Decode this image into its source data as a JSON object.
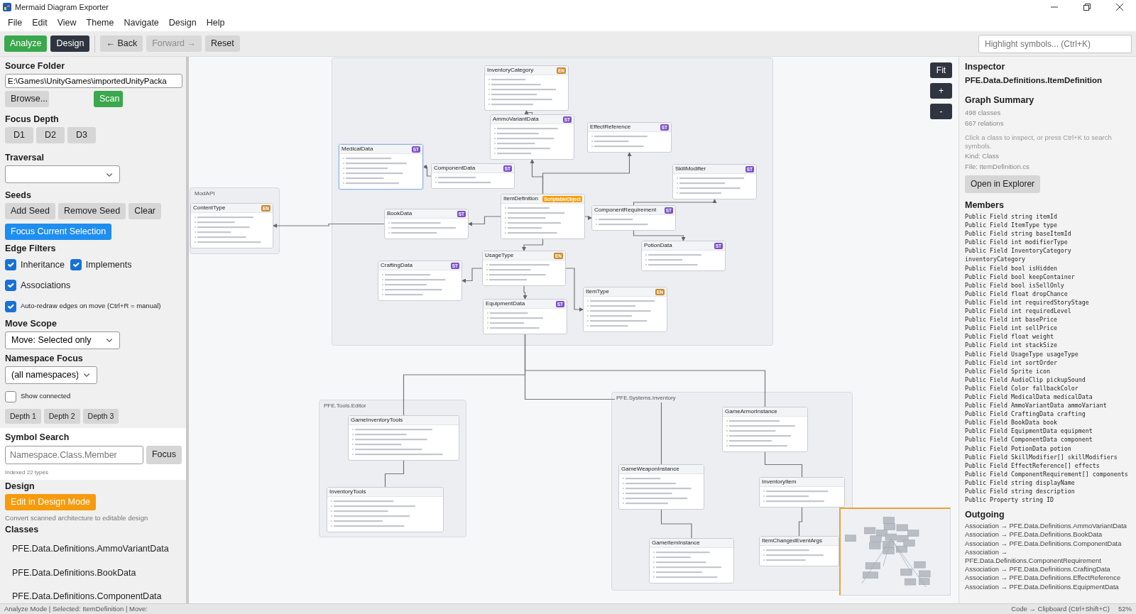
{
  "window": {
    "title": "Mermaid Diagram Exporter"
  },
  "menu": [
    "File",
    "Edit",
    "View",
    "Theme",
    "Navigate",
    "Design",
    "Help"
  ],
  "toolbar": {
    "modes": [
      {
        "label": "Analyze",
        "selected": true
      },
      {
        "label": "Design",
        "selected": false
      }
    ],
    "nav": [
      {
        "label": "← Back",
        "disabled": false
      },
      {
        "label": "Forward →",
        "disabled": true
      },
      {
        "label": "Reset",
        "disabled": false
      }
    ],
    "search": {
      "placeholder": "Highlight symbols... (Ctrl+K)"
    }
  },
  "left_panel": {
    "source_folder": {
      "label": "Source Folder",
      "value": "E:\\Games\\UnityGames\\importedUnityPacka",
      "browse": "Browse...",
      "scan": "Scan"
    },
    "focus_depth": {
      "label": "Focus Depth",
      "buttons": [
        "D1",
        "D2",
        "D3"
      ]
    },
    "traversal": {
      "label": "Traversal"
    },
    "seeds": {
      "label": "Seeds",
      "buttons": [
        "Add Seed",
        "Remove Seed",
        "Clear"
      ],
      "focus": "Focus Current Selection"
    },
    "edge_filters": {
      "label": "Edge Filters",
      "items": [
        {
          "label": "Inheritance",
          "checked": true
        },
        {
          "label": "Implements",
          "checked": true
        },
        {
          "label": "Associations",
          "checked": true
        },
        {
          "label": "Auto-redraw edges on move (Ctrl+R = manual)",
          "checked": true
        }
      ]
    },
    "move_scope": {
      "label": "Move Scope",
      "value": "Move: Selected only"
    },
    "namespace_focus": {
      "label": "Namespace Focus",
      "value": "(all namespaces)",
      "show_connected": {
        "label": "Show connected",
        "checked": false
      },
      "depth_buttons": [
        "Depth 1",
        "Depth 2",
        "Depth 3"
      ]
    },
    "symbol_search": {
      "label": "Symbol Search",
      "placeholder": "Namespace.Class.Member",
      "button": "Focus",
      "note": "Indexed 22 types"
    },
    "design": {
      "label": "Design",
      "button": "Edit in Design Mode",
      "note": "Convert scanned architecture to editable design"
    },
    "classes": {
      "label": "Classes",
      "items": [
        "PFE.Data.Definitions.AmmoVariantData",
        "PFE.Data.Definitions.BookData",
        "PFE.Data.Definitions.ComponentData"
      ]
    }
  },
  "canvas": {
    "groups": [
      {
        "label": "ModAPI"
      },
      {
        "label": "PFE.Tools.Editor"
      },
      {
        "label": "PFE.Systems.Inventory"
      }
    ],
    "nodes": [
      {
        "title": "InventoryCategory",
        "badge": "EN",
        "color": "#c98a2b",
        "selected": false
      },
      {
        "title": "AmmoVariantData",
        "badge": "ST",
        "color": "#7b4fc9",
        "selected": false
      },
      {
        "title": "EffectReference",
        "badge": "ST",
        "color": "#7b4fc9",
        "selected": false
      },
      {
        "title": "MedicalData",
        "badge": "ST",
        "color": "#7b4fc9",
        "selected": true
      },
      {
        "title": "ComponentData",
        "badge": "ST",
        "color": "#7b4fc9",
        "selected": false
      },
      {
        "title": "SkillModifier",
        "badge": "ST",
        "color": "#7b4fc9",
        "selected": false
      },
      {
        "title": "ContentType",
        "badge": "EN",
        "color": "#c98a2b",
        "selected": false
      },
      {
        "title": "BookData",
        "badge": "ST",
        "color": "#7b4fc9",
        "selected": false
      },
      {
        "title": "ItemDefinition",
        "badge": "ScriptableObject",
        "color": "#f59e0b",
        "selected": false
      },
      {
        "title": "ComponentRequirement",
        "badge": "ST",
        "color": "#7b4fc9",
        "selected": false
      },
      {
        "title": "UsageType",
        "badge": "EN",
        "color": "#c98a2b",
        "selected": false
      },
      {
        "title": "PotionData",
        "badge": "ST",
        "color": "#7b4fc9",
        "selected": false
      },
      {
        "title": "CraftingData",
        "badge": "ST",
        "color": "#7b4fc9",
        "selected": false
      },
      {
        "title": "EquipmentData",
        "badge": "ST",
        "color": "#7b4fc9",
        "selected": false
      },
      {
        "title": "ItemType",
        "badge": "EN",
        "color": "#c98a2b",
        "selected": false
      },
      {
        "title": "GameInventoryTools",
        "selected": false
      },
      {
        "title": "GameArmorInstance",
        "selected": false
      },
      {
        "title": "InventoryTools",
        "selected": false
      },
      {
        "title": "GameWeaponInstance",
        "selected": false
      },
      {
        "title": "InventoryItem",
        "selected": false
      },
      {
        "title": "GameItemInstance",
        "selected": false
      },
      {
        "title": "ItemChangedEventArgs",
        "selected": false
      }
    ],
    "zoom_controls": [
      "Fit",
      "+",
      "-"
    ]
  },
  "inspector": {
    "title": "Inspector",
    "selected_class": "PFE.Data.Definitions.ItemDefinition",
    "summary": {
      "title": "Graph Summary",
      "lines": [
        "498 classes",
        "667 relations"
      ]
    },
    "hint": "Click a class to inspect, or press Ctrl+K to search symbols.",
    "details": [
      "Kind: Class",
      "File: ItemDefinition.cs"
    ],
    "open_button": "Open in Explorer",
    "members_title": "Members",
    "members": [
      "Public Field string itemId",
      "Public Field ItemType type",
      "Public Field string baseItemId",
      "Public Field int modifierType",
      "Public Field InventoryCategory inventoryCategory",
      "Public Field bool isHidden",
      "Public Field bool keepContainer",
      "Public Field bool isSellOnly",
      "Public Field float dropChance",
      "Public Field int requiredStoryStage",
      "Public Field int requiredLevel",
      "Public Field int basePrice",
      "Public Field int sellPrice",
      "Public Field float weight",
      "Public Field int stackSize",
      "Public Field UsageType usageType",
      "Public Field int sortOrder",
      "Public Field Sprite icon",
      "Public Field AudioClip pickupSound",
      "Public Field Color fallbackColor",
      "Public Field MedicalData medicalData",
      "Public Field AmmoVariantData ammoVariant",
      "Public Field CraftingData crafting",
      "Public Field BookData book",
      "Public Field EquipmentData equipment",
      "Public Field ComponentData component",
      "Public Field PotionData potion",
      "Public Field SkillModifier[] skillModifiers",
      "Public Field EffectReference[] effects",
      "Public Field ComponentRequirement[] components",
      "Public Field string displayName",
      "Public Field string description",
      "Public Property string ID"
    ],
    "outgoing_title": "Outgoing",
    "outgoing": [
      "Association → PFE.Data.Definitions.AmmoVariantData",
      "Association → PFE.Data.Definitions.BookData",
      "Association → PFE.Data.Definitions.ComponentData",
      "Association → PFE.Data.Definitions.ComponentRequirement",
      "Association → PFE.Data.Definitions.CraftingData",
      "Association → PFE.Data.Definitions.EffectReference",
      "Association → PFE.Data.Definitions.EquipmentData"
    ]
  },
  "status_bar": {
    "left": "Analyze Mode | Selected: ItemDefinition | Move:",
    "shortcut": "Code → Clipboard (Ctrl+Shift+C)",
    "zoom": "52%"
  }
}
